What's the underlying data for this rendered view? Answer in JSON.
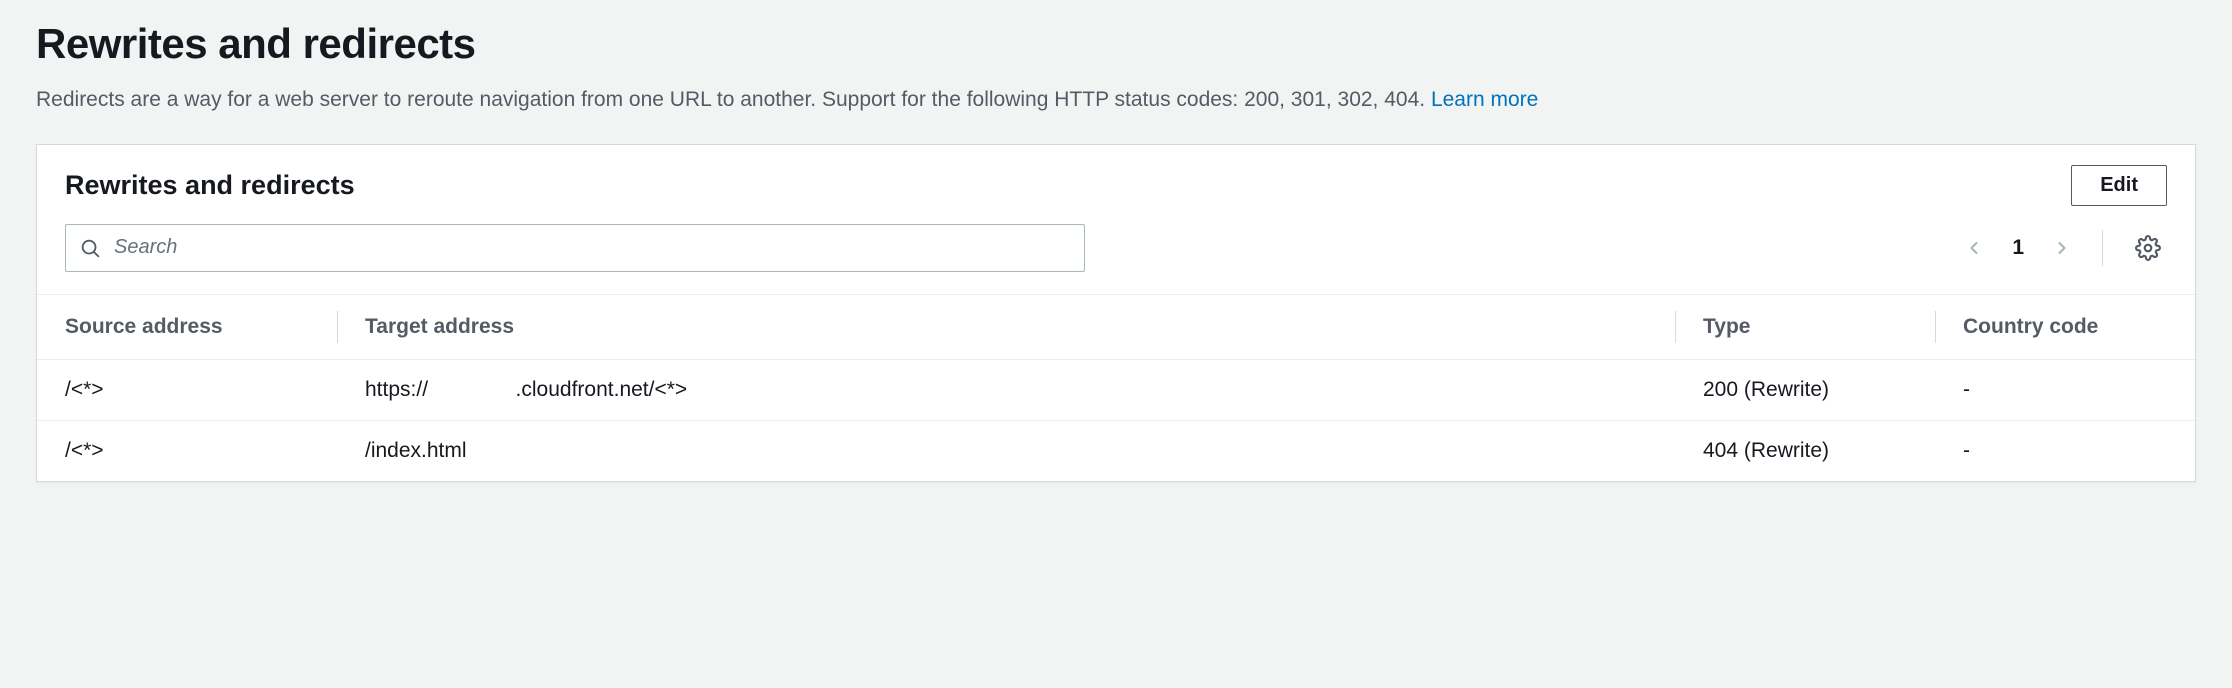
{
  "page": {
    "title": "Rewrites and redirects",
    "description": "Redirects are a way for a web server to reroute navigation from one URL to another. Support for the following HTTP status codes: 200, 301, 302, 404.",
    "learn_more": "Learn more"
  },
  "panel": {
    "title": "Rewrites and redirects",
    "edit_label": "Edit",
    "search_placeholder": "Search",
    "page_number": "1"
  },
  "table": {
    "headers": {
      "source": "Source address",
      "target": "Target address",
      "type": "Type",
      "country": "Country code"
    },
    "rows": [
      {
        "source": "/<*>",
        "target": "https://               .cloudfront.net/<*>",
        "type": "200 (Rewrite)",
        "country": "-"
      },
      {
        "source": "/<*>",
        "target": "/index.html",
        "type": "404 (Rewrite)",
        "country": "-"
      }
    ]
  }
}
